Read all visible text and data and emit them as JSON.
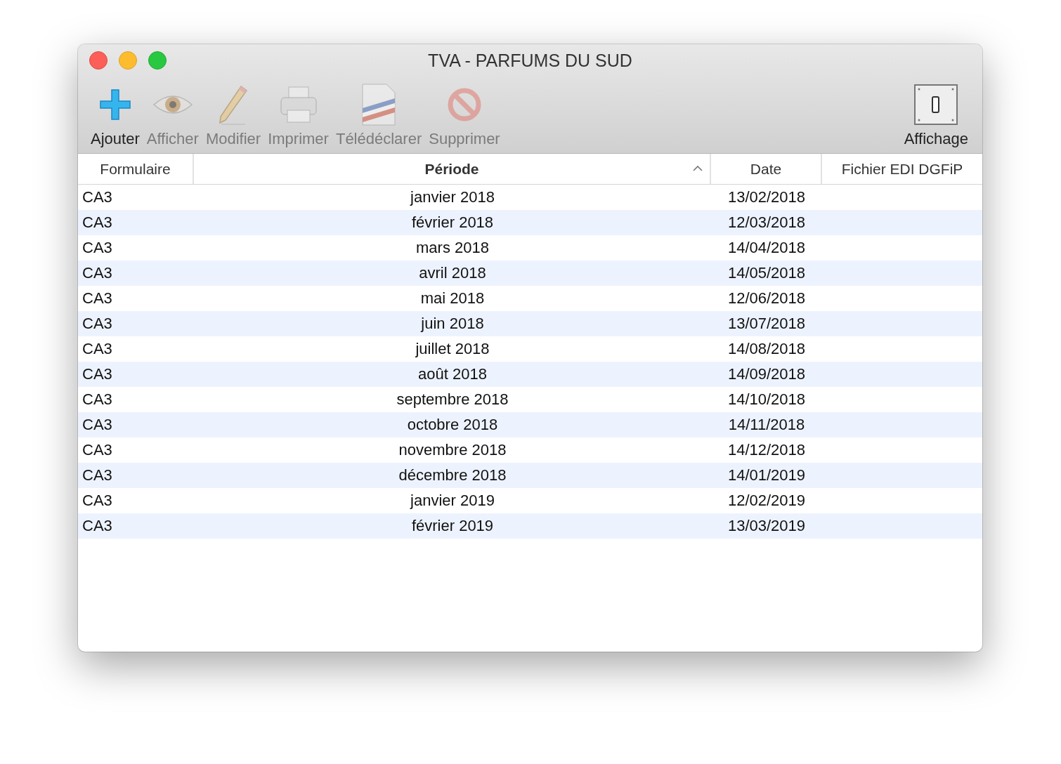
{
  "window": {
    "title": "TVA - PARFUMS DU SUD"
  },
  "toolbar": {
    "items": [
      {
        "kind": "add",
        "label": "Ajouter",
        "disabled": false
      },
      {
        "kind": "view",
        "label": "Afficher",
        "disabled": true
      },
      {
        "kind": "edit",
        "label": "Modifier",
        "disabled": true
      },
      {
        "kind": "print",
        "label": "Imprimer",
        "disabled": true
      },
      {
        "kind": "declare",
        "label": "Télédéclarer",
        "disabled": true
      },
      {
        "kind": "delete",
        "label": "Supprimer",
        "disabled": true
      }
    ],
    "right": {
      "kind": "switch",
      "label": "Affichage",
      "disabled": false
    }
  },
  "table": {
    "columns": [
      {
        "label": "Formulaire",
        "sorted": false
      },
      {
        "label": "Période",
        "sorted": true
      },
      {
        "label": "Date",
        "sorted": false
      },
      {
        "label": "Fichier EDI DGFiP",
        "sorted": false
      }
    ],
    "rows": [
      {
        "form": "CA3",
        "period": "janvier 2018",
        "date": "13/02/2018"
      },
      {
        "form": "CA3",
        "period": "février 2018",
        "date": "12/03/2018"
      },
      {
        "form": "CA3",
        "period": "mars 2018",
        "date": "14/04/2018"
      },
      {
        "form": "CA3",
        "period": "avril 2018",
        "date": "14/05/2018"
      },
      {
        "form": "CA3",
        "period": "mai 2018",
        "date": "12/06/2018"
      },
      {
        "form": "CA3",
        "period": "juin 2018",
        "date": "13/07/2018"
      },
      {
        "form": "CA3",
        "period": "juillet 2018",
        "date": "14/08/2018"
      },
      {
        "form": "CA3",
        "period": "août 2018",
        "date": "14/09/2018"
      },
      {
        "form": "CA3",
        "period": "septembre 2018",
        "date": "14/10/2018"
      },
      {
        "form": "CA3",
        "period": "octobre 2018",
        "date": "14/11/2018"
      },
      {
        "form": "CA3",
        "period": "novembre 2018",
        "date": "14/12/2018"
      },
      {
        "form": "CA3",
        "period": "décembre 2018",
        "date": "14/01/2019"
      },
      {
        "form": "CA3",
        "period": "janvier 2019",
        "date": "12/02/2019"
      },
      {
        "form": "CA3",
        "period": "février 2019",
        "date": "13/03/2019"
      }
    ]
  }
}
